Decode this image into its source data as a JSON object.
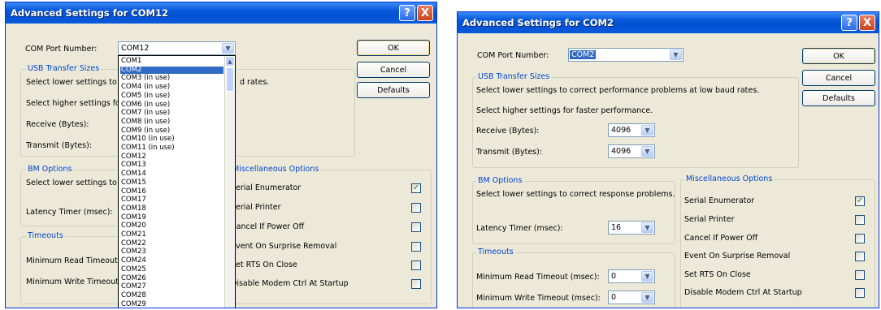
{
  "window1": {
    "title": "Advanced Settings for COM12",
    "help_glyph": "?",
    "close_glyph": "X",
    "com_port_label": "COM Port Number:",
    "com_port_value": "COM12",
    "ok_label": "OK",
    "cancel_label": "Cancel",
    "defaults_label": "Defaults",
    "usb_title": "USB Transfer Sizes",
    "usb_line1": "Select lower settings to corre",
    "usb_line1_tail": "d rates.",
    "usb_line2": "Select higher settings for fas",
    "receive_label": "Receive (Bytes):",
    "transmit_label": "Transmit (Bytes):",
    "bm_title": "BM Options",
    "bm_line": "Select lower settings to corre",
    "latency_label": "Latency Timer (msec):",
    "timeouts_title": "Timeouts",
    "min_read_label": "Minimum Read Timeout (msec",
    "min_write_label": "Minimum Write Timeout (msec",
    "misc_title": "Miscellaneous Options",
    "misc_options": [
      {
        "label": "Serial Enumerator",
        "checked": true
      },
      {
        "label": "Serial Printer",
        "checked": false
      },
      {
        "label": "Cancel If Power Off",
        "checked": false
      },
      {
        "label": "Event On Surprise Removal",
        "checked": false
      },
      {
        "label": "Set RTS On Close",
        "checked": false
      },
      {
        "label": "Disable Modem Ctrl At Startup",
        "checked": false
      }
    ],
    "dropdown_items": [
      "COM1",
      "COM2",
      "COM3 (in use)",
      "COM4 (in use)",
      "COM5 (in use)",
      "COM6 (in use)",
      "COM7 (in use)",
      "COM8 (in use)",
      "COM9 (in use)",
      "COM10 (in use)",
      "COM11 (in use)",
      "COM12",
      "COM13",
      "COM14",
      "COM15",
      "COM16",
      "COM17",
      "COM18",
      "COM19",
      "COM20",
      "COM21",
      "COM22",
      "COM23",
      "COM24",
      "COM25",
      "COM26",
      "COM27",
      "COM28",
      "COM29"
    ],
    "dropdown_selected": "COM2"
  },
  "window2": {
    "title": "Advanced Settings for COM2",
    "help_glyph": "?",
    "close_glyph": "X",
    "com_port_label": "COM Port Number:",
    "com_port_value": "COM2",
    "ok_label": "OK",
    "cancel_label": "Cancel",
    "defaults_label": "Defaults",
    "usb_title": "USB Transfer Sizes",
    "usb_line1": "Select lower settings to correct performance problems at low baud rates.",
    "usb_line2": "Select higher settings for faster performance.",
    "receive_label": "Receive (Bytes):",
    "receive_value": "4096",
    "transmit_label": "Transmit (Bytes):",
    "transmit_value": "4096",
    "bm_title": "BM Options",
    "bm_line": "Select lower settings to correct response problems.",
    "latency_label": "Latency Timer (msec):",
    "latency_value": "16",
    "timeouts_title": "Timeouts",
    "min_read_label": "Minimum Read Timeout (msec):",
    "min_read_value": "0",
    "min_write_label": "Minimum Write Timeout (msec):",
    "min_write_value": "0",
    "misc_title": "Miscellaneous Options",
    "misc_options": [
      {
        "label": "Serial Enumerator",
        "checked": true
      },
      {
        "label": "Serial Printer",
        "checked": false
      },
      {
        "label": "Cancel If Power Off",
        "checked": false
      },
      {
        "label": "Event On Surprise Removal",
        "checked": false
      },
      {
        "label": "Set RTS On Close",
        "checked": false
      },
      {
        "label": "Disable Modem Ctrl At Startup",
        "checked": false
      }
    ]
  },
  "icons": {
    "combo_arrow": "▼",
    "scroll_up": "▲",
    "check": "✓"
  }
}
